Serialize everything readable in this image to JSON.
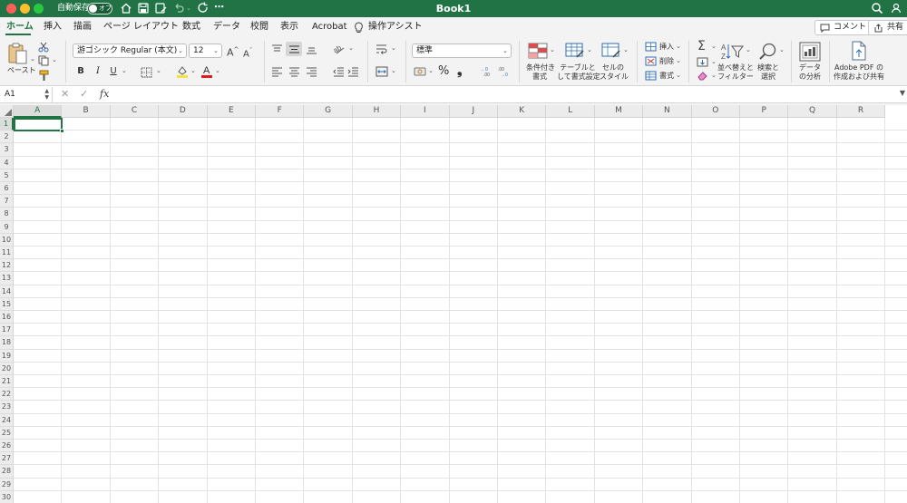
{
  "window": {
    "autosave_label": "自動保存",
    "autosave_state": "オフ",
    "title": "Book1"
  },
  "tabs": [
    {
      "label": "ホーム",
      "active": true
    },
    {
      "label": "挿入"
    },
    {
      "label": "描画"
    },
    {
      "label": "ページ レイアウト"
    },
    {
      "label": "数式"
    },
    {
      "label": "データ"
    },
    {
      "label": "校閲"
    },
    {
      "label": "表示"
    },
    {
      "label": "Acrobat"
    },
    {
      "label": "操作アシスト"
    }
  ],
  "top_buttons": {
    "comment": "コメント",
    "share": "共有"
  },
  "ribbon": {
    "paste_label": "ペースト",
    "font_name": "游ゴシック Regular (本文)",
    "font_size": "12",
    "bold": "B",
    "italic": "I",
    "underline": "U",
    "number_format": "標準",
    "percent": "%",
    "comma": "❟",
    "cond_format": [
      "条件付き",
      "書式"
    ],
    "table_format": [
      "テーブルと",
      "して書式設定"
    ],
    "cell_style": [
      "セルの",
      "スタイル"
    ],
    "insert": "挿入",
    "delete": "削除",
    "format": "書式",
    "sort_filter": [
      "並べ替えと",
      "フィルター"
    ],
    "find_select": [
      "検索と",
      "選択"
    ],
    "data_analysis": [
      "データ",
      "の分析"
    ],
    "adobe_pdf": [
      "Adobe PDF の",
      "作成および共有"
    ]
  },
  "formula_bar": {
    "name_box": "A1",
    "fx": "fx"
  },
  "grid": {
    "columns": [
      "A",
      "B",
      "C",
      "D",
      "E",
      "F",
      "G",
      "H",
      "I",
      "J",
      "K",
      "L",
      "M",
      "N",
      "O",
      "P",
      "Q",
      "R"
    ],
    "rows": [
      "1",
      "2",
      "3",
      "4",
      "5",
      "6",
      "7",
      "8",
      "9",
      "10",
      "11",
      "12",
      "13",
      "14",
      "15",
      "16",
      "17",
      "18",
      "19",
      "20",
      "21",
      "22",
      "23",
      "24",
      "25",
      "26",
      "27",
      "28",
      "29",
      "30"
    ],
    "active_cell": "A1"
  },
  "colors": {
    "accent": "#217346"
  }
}
